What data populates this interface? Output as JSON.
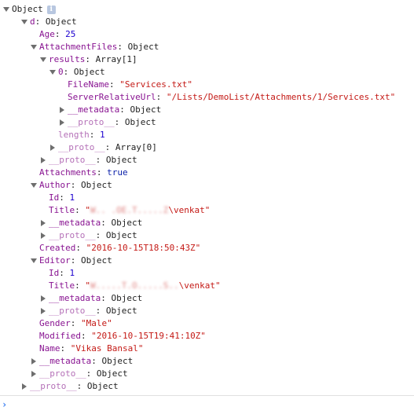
{
  "console": {
    "root": {
      "label": "Object",
      "info": "i"
    },
    "d": {
      "key": "d",
      "value": "Object"
    },
    "age": {
      "key": "Age",
      "value": "25"
    },
    "attachment_files": {
      "key": "AttachmentFiles",
      "value": "Object"
    },
    "results": {
      "key": "results",
      "value": "Array[1]"
    },
    "item0": {
      "key": "0",
      "value": "Object"
    },
    "file_name": {
      "key": "FileName",
      "value": "\"Services.txt\""
    },
    "server_relative_url": {
      "key": "ServerRelativeUrl",
      "value": "\"/Lists/DemoList/Attachments/1/Services.txt\""
    },
    "item0_metadata": {
      "key": "__metadata",
      "value": "Object"
    },
    "item0_proto": {
      "key": "__proto__",
      "value": "Object"
    },
    "length": {
      "key": "length",
      "value": "1"
    },
    "results_proto": {
      "key": "__proto__",
      "value": "Array[0]"
    },
    "attachment_files_proto": {
      "key": "__proto__",
      "value": "Object"
    },
    "attachments": {
      "key": "Attachments",
      "value": "true"
    },
    "author": {
      "key": "Author",
      "value": "Object"
    },
    "author_id": {
      "key": "Id",
      "value": "1"
    },
    "author_title": {
      "key": "Title",
      "open_quote": "\"",
      "redacted": "W.. .OE.T.....Z",
      "visible": "\\venkat",
      "close_quote": "\""
    },
    "author_metadata": {
      "key": "__metadata",
      "value": "Object"
    },
    "author_proto": {
      "key": "__proto__",
      "value": "Object"
    },
    "created": {
      "key": "Created",
      "value": "\"2016-10-15T18:50:43Z\""
    },
    "editor": {
      "key": "Editor",
      "value": "Object"
    },
    "editor_id": {
      "key": "Id",
      "value": "1"
    },
    "editor_title": {
      "key": "Title",
      "open_quote": "\"",
      "redacted": "W.....T.O.....S..",
      "visible": "\\venkat",
      "close_quote": "\""
    },
    "editor_metadata": {
      "key": "__metadata",
      "value": "Object"
    },
    "editor_proto": {
      "key": "__proto__",
      "value": "Object"
    },
    "gender": {
      "key": "Gender",
      "value": "\"Male\""
    },
    "modified": {
      "key": "Modified",
      "value": "\"2016-10-15T19:41:10Z\""
    },
    "name": {
      "key": "Name",
      "value": "\"Vikas Bansal\""
    },
    "d_metadata": {
      "key": "__metadata",
      "value": "Object"
    },
    "d_proto": {
      "key": "__proto__",
      "value": "Object"
    },
    "root_proto": {
      "key": "__proto__",
      "value": "Object"
    }
  },
  "prompt": {
    "symbol": "›",
    "value": ""
  },
  "colors": {
    "key": "#881391",
    "proto_key": "#b571b8",
    "string": "#c41a16",
    "number": "#1c00cf",
    "boolean": "#0d22aa",
    "prompt": "#367cf1"
  }
}
